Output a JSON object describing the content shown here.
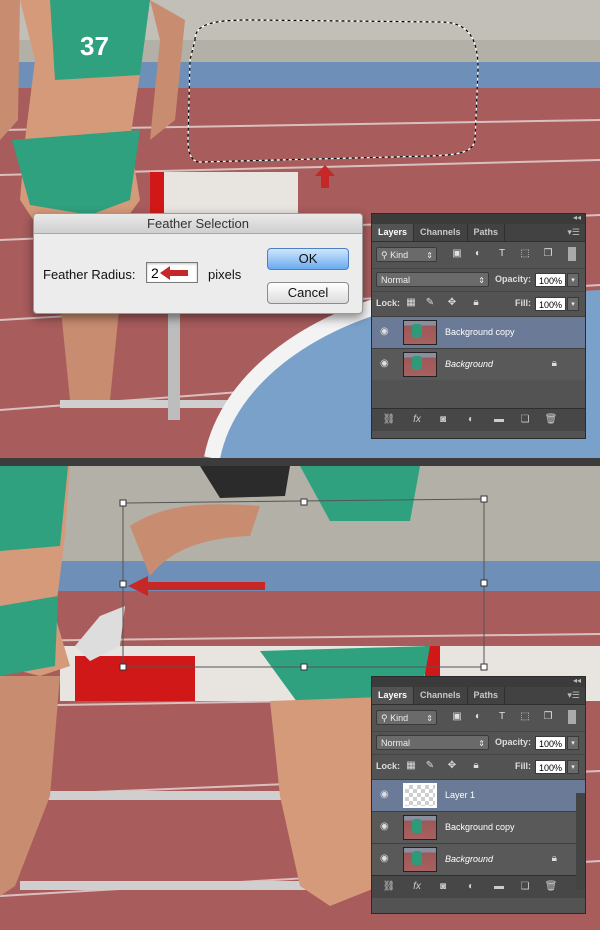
{
  "dialog": {
    "title": "Feather Selection",
    "radius_label": "Feather Radius:",
    "radius_value": "2",
    "unit": "pixels",
    "ok_label": "OK",
    "cancel_label": "Cancel"
  },
  "bib": "37",
  "panel_top": {
    "tabs": [
      "Layers",
      "Channels",
      "Paths"
    ],
    "kind": "Kind",
    "blend_mode": "Normal",
    "opacity_label": "Opacity:",
    "opacity_value": "100%",
    "lock_label": "Lock:",
    "fill_label": "Fill:",
    "fill_value": "100%",
    "layers": [
      {
        "name": "Background copy",
        "selected": true
      },
      {
        "name": "Background",
        "selected": false,
        "locked": true
      }
    ]
  },
  "panel_bottom": {
    "tabs": [
      "Layers",
      "Channels",
      "Paths"
    ],
    "kind": "Kind",
    "blend_mode": "Normal",
    "opacity_label": "Opacity:",
    "opacity_value": "100%",
    "lock_label": "Lock:",
    "fill_label": "Fill:",
    "fill_value": "100%",
    "layers": [
      {
        "name": "Layer 1",
        "selected": true
      },
      {
        "name": "Background copy",
        "selected": false
      },
      {
        "name": "Background",
        "selected": false,
        "locked": true
      }
    ]
  },
  "colors": {
    "track": "#a85c5c",
    "accent_arrow": "#c62828",
    "jersey": "#2fa17e",
    "selected_layer": "#6b7a96"
  },
  "icons": [
    "eye-icon",
    "lock-icon",
    "link-icon",
    "fx-icon",
    "mask-icon",
    "adjustment-icon",
    "folder-icon",
    "new-layer-icon",
    "trash-icon",
    "search-icon"
  ]
}
